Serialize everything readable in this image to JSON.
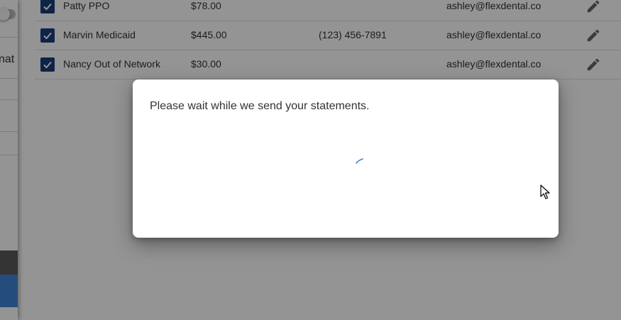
{
  "dialog": {
    "message": "Please wait while we send your statements."
  },
  "left_panel": {
    "partial_text": "nat a"
  },
  "table": {
    "rows": [
      {
        "checked": true,
        "name": "Patty PPO",
        "amount": "$78.00",
        "phone": "",
        "email": "ashley@flexdental.co"
      },
      {
        "checked": true,
        "name": "Marvin Medicaid",
        "amount": "$445.00",
        "phone": "(123) 456-7891",
        "email": "ashley@flexdental.co"
      },
      {
        "checked": true,
        "name": "Nancy Out of Network",
        "amount": "$30.00",
        "phone": "",
        "email": "ashley@flexdental.co"
      }
    ]
  },
  "icons": {
    "checkbox": "check-icon",
    "row_action": "pencil-edit-icon",
    "loading": "spinner-icon",
    "pointer": "mouse-cursor-icon"
  },
  "colors": {
    "checkbox": "#1a3d7c",
    "accent_blue": "#3f85d8",
    "overlay": "rgba(0,0,0,0.42)",
    "spinner": "#3f85d8"
  }
}
